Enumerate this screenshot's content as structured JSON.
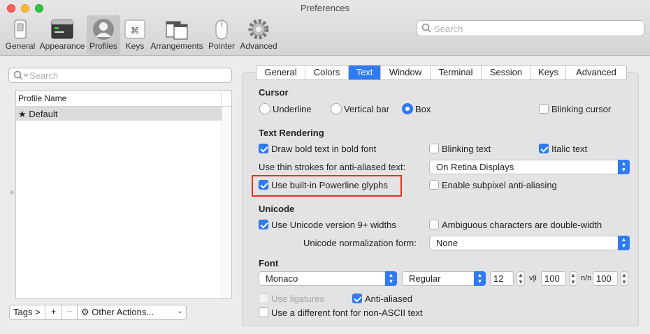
{
  "window": {
    "title": "Preferences"
  },
  "colors": {
    "accent": "#2f7bf5",
    "highlight": "#e3321e",
    "close": "#fe5f57",
    "minimize": "#febc2e",
    "zoom": "#28c840"
  },
  "toolbar": [
    {
      "label": "General",
      "icon": "switch-icon"
    },
    {
      "label": "Appearance",
      "icon": "window-icon"
    },
    {
      "label": "Profiles",
      "icon": "person-icon",
      "selected": true
    },
    {
      "label": "Keys",
      "icon": "command-key-icon"
    },
    {
      "label": "Arrangements",
      "icon": "windows-icon"
    },
    {
      "label": "Pointer",
      "icon": "mouse-icon"
    },
    {
      "label": "Advanced",
      "icon": "gear-icon"
    }
  ],
  "search": {
    "placeholder": "Search"
  },
  "sidebar": {
    "search_placeholder": "Search",
    "column_header": "Profile Name",
    "profiles": [
      {
        "name": "Default",
        "icon": "star-icon"
      }
    ],
    "tags_label": "Tags >",
    "add_label": "+",
    "remove_label": "−",
    "other_actions_label": "Other Actions..."
  },
  "tabs": [
    {
      "label": "General"
    },
    {
      "label": "Colors"
    },
    {
      "label": "Text",
      "active": true
    },
    {
      "label": "Window"
    },
    {
      "label": "Terminal"
    },
    {
      "label": "Session"
    },
    {
      "label": "Keys"
    },
    {
      "label": "Advanced"
    }
  ],
  "cursor": {
    "heading": "Cursor",
    "underline": "Underline",
    "vertical_bar": "Vertical bar",
    "box": "Box",
    "selected": "Box",
    "blinking": {
      "label": "Blinking cursor",
      "checked": false
    }
  },
  "text_rendering": {
    "heading": "Text Rendering",
    "bold": {
      "label": "Draw bold text in bold font",
      "checked": true
    },
    "blinking_text": {
      "label": "Blinking text",
      "checked": false
    },
    "italic": {
      "label": "Italic text",
      "checked": true
    },
    "thin_strokes_label": "Use thin strokes for anti-aliased text:",
    "thin_strokes_value": "On Retina Displays",
    "powerline": {
      "label": "Use built-in Powerline glyphs",
      "checked": true
    },
    "subpixel": {
      "label": "Enable subpixel anti-aliasing",
      "checked": false
    }
  },
  "unicode": {
    "heading": "Unicode",
    "version9": {
      "label": "Use Unicode version 9+ widths",
      "checked": true
    },
    "ambiguous": {
      "label": "Ambiguous characters are double-width",
      "checked": false
    },
    "normalization_label": "Unicode normalization form:",
    "normalization_value": "None"
  },
  "font": {
    "heading": "Font",
    "family": "Monaco",
    "weight": "Regular",
    "size": "12",
    "vertical_spacing_glyph": "v|i",
    "vertical_spacing": "100",
    "horizontal_spacing_glyph": "n/n",
    "horizontal_spacing": "100",
    "ligatures": {
      "label": "Use ligatures",
      "checked": false,
      "disabled": true
    },
    "anti_aliased": {
      "label": "Anti-aliased",
      "checked": true
    },
    "non_ascii": {
      "label": "Use a different font for non-ASCII text",
      "checked": false
    }
  }
}
